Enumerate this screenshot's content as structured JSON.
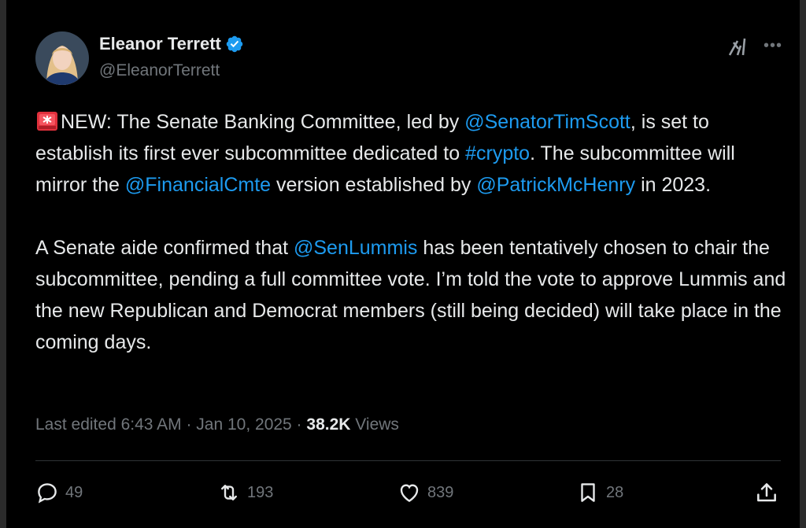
{
  "author": {
    "name": "Eleanor Terrett",
    "handle": "@EleanorTerrett",
    "verified": true
  },
  "tweet": {
    "p1": {
      "siren_icon": "rotating-light-emoji",
      "t1": "NEW: The Senate Banking Committee, led by ",
      "m1": "@SenatorTimScott",
      "t2": ", is set to establish its first ever subcommittee dedicated to ",
      "m2": "#crypto",
      "t3": ". The subcommittee will mirror the ",
      "m3": "@FinancialCmte",
      "t4": " version established by ",
      "m4": "@PatrickMcHenry",
      "t5": " in 2023."
    },
    "p2": {
      "t1": "A Senate aide confirmed that ",
      "m1": "@SenLummis",
      "t2": " has been tentatively chosen to chair the subcommittee, pending a full committee vote. I’m told the vote to approve Lummis and the new Republican and Democrat members (still being decided) will take place in the coming days."
    }
  },
  "meta": {
    "edited": "Last edited 6:43 AM · Jan 10, 2025 · ",
    "views_count": "38.2K",
    "views_label": " Views"
  },
  "actions": {
    "replies": "49",
    "reposts": "193",
    "likes": "839",
    "bookmarks": "28"
  },
  "colors": {
    "background": "#000000",
    "text": "#e7e9ea",
    "muted": "#71767b",
    "link": "#1d9bf0",
    "verified": "#1d9bf0"
  }
}
